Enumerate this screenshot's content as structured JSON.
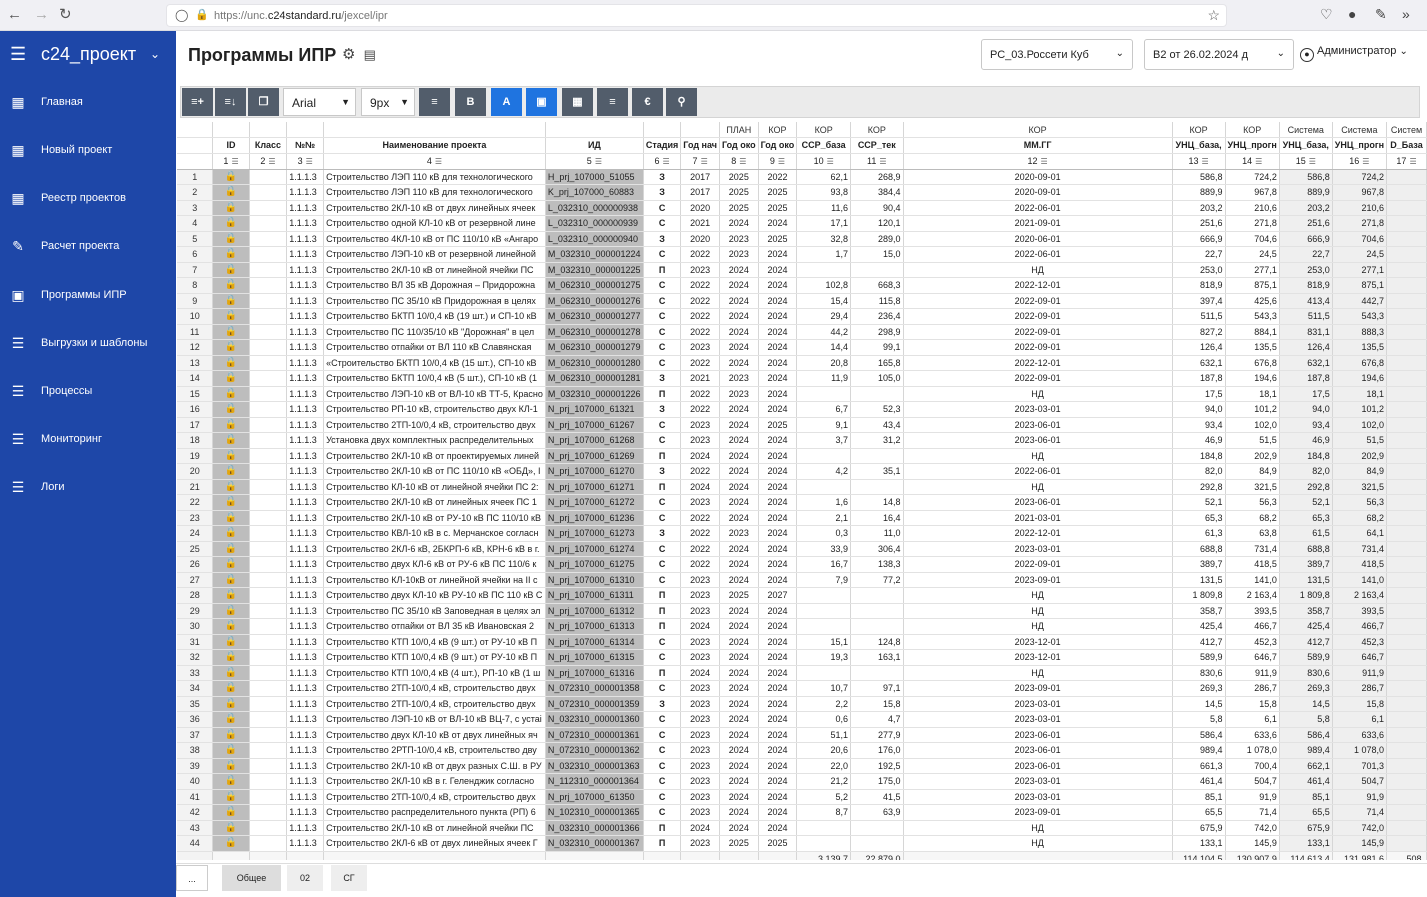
{
  "browser": {
    "url_prefix": "https://unc.",
    "url_domain": "c24standard.ru",
    "url_path": "/jexcel/ipr"
  },
  "sidebar": {
    "title": "с24_проект",
    "items": [
      {
        "label": "Главная",
        "icon": "monitor-icon"
      },
      {
        "label": "Новый проект",
        "icon": "monitor-icon"
      },
      {
        "label": "Реестр проектов",
        "icon": "monitor-icon"
      },
      {
        "label": "Расчет проекта",
        "icon": "edit-doc-icon"
      },
      {
        "label": "Программы ИПР",
        "icon": "briefcase-icon"
      },
      {
        "label": "Выгрузки и шаблоны",
        "icon": "list-doc-icon"
      },
      {
        "label": "Процессы",
        "icon": "list-doc-icon"
      },
      {
        "label": "Мониторинг",
        "icon": "list-doc-icon"
      },
      {
        "label": "Логи",
        "icon": "list-doc-icon"
      }
    ]
  },
  "header": {
    "title": "Программы ИПР",
    "org_select": "РС_03.Россети Куб",
    "version_select": "В2 от 26.02.2024 д",
    "user": "Администратор"
  },
  "toolbar": {
    "font": "Arial",
    "size": "9px",
    "bold": "B",
    "underline": "A",
    "fill": "A"
  },
  "columns": {
    "top": [
      "",
      "",
      "",
      "",
      "",
      "",
      "",
      "ПЛАН",
      "КОР",
      "КОР",
      "КОР",
      "КОР",
      "КОР",
      "КОР",
      "Система",
      "Система",
      "Систем"
    ],
    "names": [
      "ID",
      "Класс",
      "№№",
      "Наименование проекта",
      "ИД",
      "Стадия",
      "Год нач",
      "Год око",
      "Год око",
      "ССР_база",
      "ССР_тек",
      "ММ.ГГ",
      "УНЦ_база,",
      "УНЦ_прогн",
      "УНЦ_база,",
      "УНЦ_прогн",
      "D_База"
    ],
    "numbers": [
      "1",
      "2",
      "3",
      "4",
      "5",
      "6",
      "7",
      "8",
      "9",
      "10",
      "11",
      "12",
      "13",
      "14",
      "15",
      "16",
      "17"
    ]
  },
  "rows": [
    [
      "1",
      "1.1.1.3",
      "Строительство ЛЭП 110 кВ для технологического",
      "H_prj_107000_51055",
      "З",
      "2017",
      "2025",
      "2022",
      "62,1",
      "268,9",
      "2020-09-01",
      "586,8",
      "724,2",
      "586,8",
      "724,2"
    ],
    [
      "2",
      "1.1.1.3",
      "Строительство ЛЭП 110 кВ для технологического",
      "K_prj_107000_60883",
      "З",
      "2017",
      "2025",
      "2025",
      "93,8",
      "384,4",
      "2020-09-01",
      "889,9",
      "967,8",
      "889,9",
      "967,8"
    ],
    [
      "3",
      "1.1.1.3",
      "Строительство 2КЛ-10 кВ от двух линейных ячеек",
      "L_032310_000000938",
      "С",
      "2020",
      "2025",
      "2025",
      "11,6",
      "90,4",
      "2022-06-01",
      "203,2",
      "210,6",
      "203,2",
      "210,6"
    ],
    [
      "4",
      "1.1.1.3",
      "Строительство одной КЛ-10 кВ от резервной лине",
      "L_032310_000000939",
      "С",
      "2021",
      "2024",
      "2024",
      "17,1",
      "120,1",
      "2021-09-01",
      "251,6",
      "271,8",
      "251,6",
      "271,8"
    ],
    [
      "5",
      "1.1.1.3",
      "Строительство 4КЛ-10 кВ от ПС 110/10 кВ «Ангаро",
      "L_032310_000000940",
      "З",
      "2020",
      "2023",
      "2025",
      "32,8",
      "289,0",
      "2020-06-01",
      "666,9",
      "704,6",
      "666,9",
      "704,6"
    ],
    [
      "6",
      "1.1.1.3",
      "Строительство ЛЭП-10 кВ от резервной линейной",
      "M_032310_000001224",
      "С",
      "2022",
      "2023",
      "2024",
      "1,7",
      "15,0",
      "2022-06-01",
      "22,7",
      "24,5",
      "22,7",
      "24,5"
    ],
    [
      "7",
      "1.1.1.3",
      "Строительство 2КЛ-10 кВ от линейной ячейки ПС",
      "M_032310_000001225",
      "П",
      "2023",
      "2024",
      "2024",
      "",
      "",
      "НД",
      "253,0",
      "277,1",
      "253,0",
      "277,1"
    ],
    [
      "8",
      "1.1.1.3",
      "Строительство ВЛ 35 кВ Дорожная – Придорожна",
      "M_062310_000001275",
      "С",
      "2022",
      "2024",
      "2024",
      "102,8",
      "668,3",
      "2022-12-01",
      "818,9",
      "875,1",
      "818,9",
      "875,1"
    ],
    [
      "9",
      "1.1.1.3",
      "Строительство ПС 35/10 кВ Придорожная в целях",
      "M_062310_000001276",
      "С",
      "2022",
      "2024",
      "2024",
      "15,4",
      "115,8",
      "2022-09-01",
      "397,4",
      "425,6",
      "413,4",
      "442,7"
    ],
    [
      "10",
      "1.1.1.3",
      "Строительство БКТП 10/0,4 кВ (19 шт.) и СП-10 кВ",
      "M_062310_000001277",
      "С",
      "2022",
      "2024",
      "2024",
      "29,4",
      "236,4",
      "2022-09-01",
      "511,5",
      "543,3",
      "511,5",
      "543,3"
    ],
    [
      "11",
      "1.1.1.3",
      "Строительство ПС 110/35/10 кВ \"Дорожная\" в цел",
      "M_062310_000001278",
      "С",
      "2022",
      "2024",
      "2024",
      "44,2",
      "298,9",
      "2022-09-01",
      "827,2",
      "884,1",
      "831,1",
      "888,3"
    ],
    [
      "12",
      "1.1.1.3",
      "Строительство отпайки от ВЛ 110 кВ Славянская",
      "M_062310_000001279",
      "С",
      "2023",
      "2024",
      "2024",
      "14,4",
      "99,1",
      "2022-09-01",
      "126,4",
      "135,5",
      "126,4",
      "135,5"
    ],
    [
      "13",
      "1.1.1.3",
      "«Строительство БКТП 10/0,4 кВ (15 шт.), СП-10 кВ",
      "M_062310_000001280",
      "С",
      "2022",
      "2024",
      "2024",
      "20,8",
      "165,8",
      "2022-12-01",
      "632,1",
      "676,8",
      "632,1",
      "676,8"
    ],
    [
      "14",
      "1.1.1.3",
      "Строительство БКТП 10/0,4 кВ (5 шт.), СП-10 кВ (1",
      "M_062310_000001281",
      "З",
      "2021",
      "2023",
      "2024",
      "11,9",
      "105,0",
      "2022-09-01",
      "187,8",
      "194,6",
      "187,8",
      "194,6"
    ],
    [
      "15",
      "1.1.1.3",
      "Строительство ЛЭП-10 кВ от ВЛ-10 кВ ТТ-5, Красно",
      "M_032310_000001226",
      "П",
      "2022",
      "2023",
      "2024",
      "",
      "",
      "НД",
      "17,5",
      "18,1",
      "17,5",
      "18,1"
    ],
    [
      "16",
      "1.1.1.3",
      "Строительство РП-10 кВ, строительство двух КЛ-1",
      "N_prj_107000_61321",
      "З",
      "2022",
      "2024",
      "2024",
      "6,7",
      "52,3",
      "2023-03-01",
      "94,0",
      "101,2",
      "94,0",
      "101,2"
    ],
    [
      "17",
      "1.1.1.3",
      "Строительство 2ТП-10/0,4 кВ, строительство двух",
      "N_prj_107000_61267",
      "С",
      "2023",
      "2024",
      "2025",
      "9,1",
      "43,4",
      "2023-06-01",
      "93,4",
      "102,0",
      "93,4",
      "102,0"
    ],
    [
      "18",
      "1.1.1.3",
      "Установка двух комплектных распределительных",
      "N_prj_107000_61268",
      "С",
      "2023",
      "2024",
      "2024",
      "3,7",
      "31,2",
      "2023-06-01",
      "46,9",
      "51,5",
      "46,9",
      "51,5"
    ],
    [
      "19",
      "1.1.1.3",
      "Строительство 2КЛ-10 кВ от проектируемых линей",
      "N_prj_107000_61269",
      "П",
      "2024",
      "2024",
      "2024",
      "",
      "",
      "НД",
      "184,8",
      "202,9",
      "184,8",
      "202,9"
    ],
    [
      "20",
      "1.1.1.3",
      "Строительство 2КЛ-10 кВ от ПС 110/10 кВ «ОБД», I",
      "N_prj_107000_61270",
      "З",
      "2022",
      "2024",
      "2024",
      "4,2",
      "35,1",
      "2022-06-01",
      "82,0",
      "84,9",
      "82,0",
      "84,9"
    ],
    [
      "21",
      "1.1.1.3",
      "Строительство КЛ-10 кВ от линейной ячейки ПС 2:",
      "N_prj_107000_61271",
      "П",
      "2024",
      "2024",
      "2024",
      "",
      "",
      "НД",
      "292,8",
      "321,5",
      "292,8",
      "321,5"
    ],
    [
      "22",
      "1.1.1.3",
      "Строительство 2КЛ-10 кВ от линейных ячеек ПС 1",
      "N_prj_107000_61272",
      "С",
      "2023",
      "2024",
      "2024",
      "1,6",
      "14,8",
      "2023-06-01",
      "52,1",
      "56,3",
      "52,1",
      "56,3"
    ],
    [
      "23",
      "1.1.1.3",
      "Строительство 2КЛ-10 кВ от РУ-10 кВ ПС 110/10 кВ",
      "N_prj_107000_61236",
      "С",
      "2022",
      "2024",
      "2024",
      "2,1",
      "16,4",
      "2021-03-01",
      "65,3",
      "68,2",
      "65,3",
      "68,2"
    ],
    [
      "24",
      "1.1.1.3",
      "Строительство КВЛ-10 кВ в с. Мерчанское согласн",
      "N_prj_107000_61273",
      "З",
      "2022",
      "2023",
      "2024",
      "0,3",
      "11,0",
      "2022-12-01",
      "61,3",
      "63,8",
      "61,5",
      "64,1"
    ],
    [
      "25",
      "1.1.1.3",
      "Строительство 2КЛ-6 кВ, 2БКРП-6 кВ, КРН-6 кВ в г.",
      "N_prj_107000_61274",
      "С",
      "2022",
      "2024",
      "2024",
      "33,9",
      "306,4",
      "2023-03-01",
      "688,8",
      "731,4",
      "688,8",
      "731,4"
    ],
    [
      "26",
      "1.1.1.3",
      "Строительство двух КЛ-6 кВ от РУ-6 кВ ПС 110/6 к",
      "N_prj_107000_61275",
      "С",
      "2022",
      "2024",
      "2024",
      "16,7",
      "138,3",
      "2022-09-01",
      "389,7",
      "418,5",
      "389,7",
      "418,5"
    ],
    [
      "27",
      "1.1.1.3",
      "Строительство КЛ-10кВ от линейной ячейки на II с",
      "N_prj_107000_61310",
      "С",
      "2023",
      "2024",
      "2024",
      "7,9",
      "77,2",
      "2023-09-01",
      "131,5",
      "141,0",
      "131,5",
      "141,0"
    ],
    [
      "28",
      "1.1.1.3",
      "Строительство двух КЛ-10 кВ РУ-10 кВ ПС 110 кВ С",
      "N_prj_107000_61311",
      "П",
      "2023",
      "2025",
      "2027",
      "",
      "",
      "НД",
      "1 809,8",
      "2 163,4",
      "1 809,8",
      "2 163,4"
    ],
    [
      "29",
      "1.1.1.3",
      "Строительство ПС 35/10 кВ Заповедная в целях эл",
      "N_prj_107000_61312",
      "П",
      "2023",
      "2024",
      "2024",
      "",
      "",
      "НД",
      "358,7",
      "393,5",
      "358,7",
      "393,5"
    ],
    [
      "30",
      "1.1.1.3",
      "Строительство отпайки от ВЛ 35 кВ Ивановская 2",
      "N_prj_107000_61313",
      "П",
      "2024",
      "2024",
      "2024",
      "",
      "",
      "НД",
      "425,4",
      "466,7",
      "425,4",
      "466,7"
    ],
    [
      "31",
      "1.1.1.3",
      "Строительство КТП 10/0,4 кВ (9 шт.) от РУ-10 кВ П",
      "N_prj_107000_61314",
      "С",
      "2023",
      "2024",
      "2024",
      "15,1",
      "124,8",
      "2023-12-01",
      "412,7",
      "452,3",
      "412,7",
      "452,3"
    ],
    [
      "32",
      "1.1.1.3",
      "Строительство КТП 10/0,4 кВ (9 шт.) от РУ-10 кВ П",
      "N_prj_107000_61315",
      "С",
      "2023",
      "2024",
      "2024",
      "19,3",
      "163,1",
      "2023-12-01",
      "589,9",
      "646,7",
      "589,9",
      "646,7"
    ],
    [
      "33",
      "1.1.1.3",
      "Строительство КТП 10/0,4 кВ (4 шт.), РП-10 кВ (1 ш",
      "N_prj_107000_61316",
      "П",
      "2024",
      "2024",
      "2024",
      "",
      "",
      "НД",
      "830,6",
      "911,9",
      "830,6",
      "911,9"
    ],
    [
      "34",
      "1.1.1.3",
      "Строительство 2ТП-10/0,4 кВ, строительство двух",
      "N_072310_000001358",
      "С",
      "2023",
      "2024",
      "2024",
      "10,7",
      "97,1",
      "2023-09-01",
      "269,3",
      "286,7",
      "269,3",
      "286,7"
    ],
    [
      "35",
      "1.1.1.3",
      "Строительство 2ТП-10/0,4 кВ, строительство двух",
      "N_072310_000001359",
      "З",
      "2023",
      "2024",
      "2024",
      "2,2",
      "15,8",
      "2023-03-01",
      "14,5",
      "15,8",
      "14,5",
      "15,8"
    ],
    [
      "36",
      "1.1.1.3",
      "Строительство ЛЭП-10 кВ от ВЛ-10 кВ ВЦ-7, с устаі",
      "N_032310_000001360",
      "С",
      "2023",
      "2024",
      "2024",
      "0,6",
      "4,7",
      "2023-03-01",
      "5,8",
      "6,1",
      "5,8",
      "6,1"
    ],
    [
      "37",
      "1.1.1.3",
      "Строительство двух КЛ-10 кВ от двух линейных яч",
      "N_072310_000001361",
      "С",
      "2023",
      "2024",
      "2024",
      "51,1",
      "277,9",
      "2023-06-01",
      "586,4",
      "633,6",
      "586,4",
      "633,6"
    ],
    [
      "38",
      "1.1.1.3",
      "Строительство 2РТП-10/0,4 кВ, строительство дву",
      "N_072310_000001362",
      "С",
      "2023",
      "2024",
      "2024",
      "20,6",
      "176,0",
      "2023-06-01",
      "989,4",
      "1 078,0",
      "989,4",
      "1 078,0"
    ],
    [
      "39",
      "1.1.1.3",
      "Строительство 2КЛ-10 кВ от двух разных С.Ш. в РУ",
      "N_032310_000001363",
      "С",
      "2023",
      "2024",
      "2024",
      "22,0",
      "192,5",
      "2023-06-01",
      "661,3",
      "700,4",
      "662,1",
      "701,3"
    ],
    [
      "40",
      "1.1.1.3",
      "Строительство 2КЛ-10 кВ в г. Геленджик согласно",
      "N_112310_000001364",
      "С",
      "2023",
      "2024",
      "2024",
      "21,2",
      "175,0",
      "2023-03-01",
      "461,4",
      "504,7",
      "461,4",
      "504,7"
    ],
    [
      "41",
      "1.1.1.3",
      "Строительство 2ТП-10/0,4 кВ, строительство двух",
      "N_prj_107000_61350",
      "С",
      "2023",
      "2024",
      "2024",
      "5,2",
      "41,5",
      "2023-03-01",
      "85,1",
      "91,9",
      "85,1",
      "91,9"
    ],
    [
      "42",
      "1.1.1.3",
      "Строительство распределительного пункта (РП) 6",
      "N_102310_000001365",
      "С",
      "2023",
      "2024",
      "2024",
      "8,7",
      "63,9",
      "2023-09-01",
      "65,5",
      "71,4",
      "65,5",
      "71,4"
    ],
    [
      "43",
      "1.1.1.3",
      "Строительство 2КЛ-10 кВ от линейной ячейки ПС",
      "N_032310_000001366",
      "П",
      "2024",
      "2024",
      "2024",
      "",
      "",
      "НД",
      "675,9",
      "742,0",
      "675,9",
      "742,0"
    ],
    [
      "44",
      "1.1.1.3",
      "Строительство 2КЛ-6 кВ от двух линейных ячеек Г",
      "N_032310_000001367",
      "П",
      "2023",
      "2025",
      "2025",
      "",
      "",
      "НД",
      "133,1",
      "145,9",
      "133,1",
      "145,9"
    ]
  ],
  "totals": {
    "ssr_base": "3 139,7",
    "ssr_tek": "22 879,0",
    "unc_base": "114 104,5",
    "unc_prog": "130 907,9",
    "sys_base": "114 613,4",
    "sys_prog": "131 981,6",
    "d_base": "508,"
  },
  "tabs": [
    "...",
    "Общее",
    "02",
    "СГ"
  ]
}
